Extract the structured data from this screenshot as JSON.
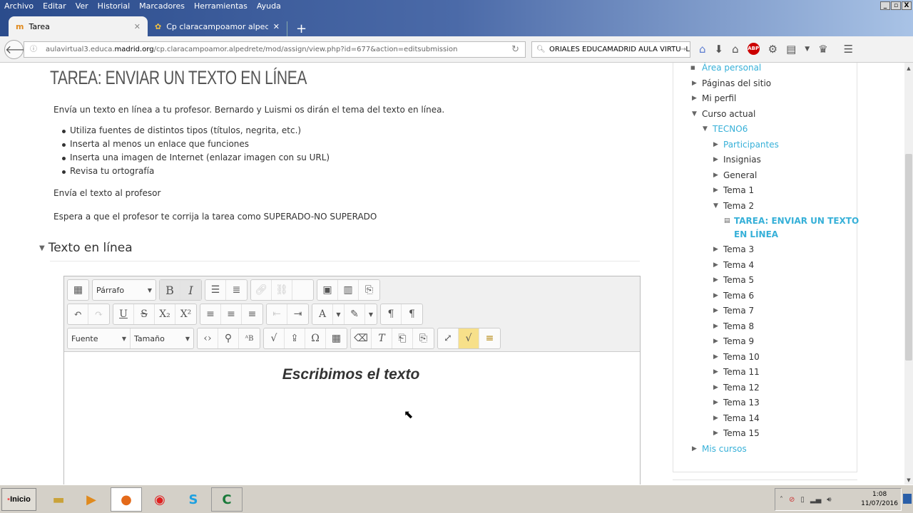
{
  "browser": {
    "menu": [
      "Archivo",
      "Editar",
      "Ver",
      "Historial",
      "Marcadores",
      "Herramientas",
      "Ayuda"
    ],
    "tabs": [
      {
        "title": "Tarea",
        "icon": "moodle-icon",
        "active": true
      },
      {
        "title": "Cp claracampoamor alpedrete...",
        "icon": "school-logo-icon",
        "active": false
      }
    ],
    "new_tab": "+",
    "url_prefix": "aulavirtual3.educa.",
    "url_domain": "madrid.org",
    "url_path": "/cp.claracampoamor.alpedrete/mod/assign/view.php?id=677&action=editsubmission",
    "search_value": "ORIALES EDUCAMADRID AULA VIRTUAL",
    "toolbar_icons": [
      "pocket-icon",
      "download-icon",
      "home-icon",
      "adblock-icon",
      "extension-icon",
      "clipboard-icon",
      "chevron-down-icon",
      "crown-icon",
      "menu-icon"
    ],
    "abp_label": "ABP"
  },
  "page": {
    "title": "TAREA: ENVIAR UN TEXTO EN LÍNEA",
    "intro": "Envía un texto en línea a tu profesor. Bernardo y Luismi os dirán el tema del texto en línea.",
    "bullets": [
      "Utiliza fuentes de distintos tipos (títulos, negrita, etc.)",
      "Inserta al menos un enlace que funciones",
      "Inserta una imagen de Internet (enlazar imagen con su URL)",
      "Revisa tu ortografía"
    ],
    "send": "Envía el texto al profesor",
    "wait": "Espera a que el profesor te corrija la tarea como SUPERADO-NO SUPERADO",
    "section": "Texto en línea",
    "editor": {
      "paragraph_select": "Párrafo",
      "font_select": "Fuente",
      "size_select": "Tamaño",
      "content": "Escribimos el texto"
    }
  },
  "sidebar": {
    "items": [
      {
        "label": "Área personal",
        "level": 0,
        "mark": "bullet",
        "link": true
      },
      {
        "label": "Páginas del sitio",
        "level": 0,
        "mark": "collapsed",
        "link": false
      },
      {
        "label": "Mi perfil",
        "level": 0,
        "mark": "collapsed",
        "link": false
      },
      {
        "label": "Curso actual",
        "level": 0,
        "mark": "expanded",
        "link": false
      },
      {
        "label": "TECNO6",
        "level": 1,
        "mark": "expanded",
        "link": true
      },
      {
        "label": "Participantes",
        "level": 2,
        "mark": "collapsed",
        "link": true
      },
      {
        "label": "Insignias",
        "level": 2,
        "mark": "collapsed",
        "link": false
      },
      {
        "label": "General",
        "level": 2,
        "mark": "collapsed",
        "link": false
      },
      {
        "label": "Tema 1",
        "level": 2,
        "mark": "collapsed",
        "link": false
      },
      {
        "label": "Tema 2",
        "level": 2,
        "mark": "expanded",
        "link": false
      },
      {
        "label": "TAREA: ENVIAR UN TEXTO",
        "label2": "EN LÍNEA",
        "level": 3,
        "mark": "assign",
        "link": true,
        "bold": true
      },
      {
        "label": "Tema 3",
        "level": 2,
        "mark": "collapsed",
        "link": false
      },
      {
        "label": "Tema 4",
        "level": 2,
        "mark": "collapsed",
        "link": false
      },
      {
        "label": "Tema 5",
        "level": 2,
        "mark": "collapsed",
        "link": false
      },
      {
        "label": "Tema 6",
        "level": 2,
        "mark": "collapsed",
        "link": false
      },
      {
        "label": "Tema 7",
        "level": 2,
        "mark": "collapsed",
        "link": false
      },
      {
        "label": "Tema 8",
        "level": 2,
        "mark": "collapsed",
        "link": false
      },
      {
        "label": "Tema 9",
        "level": 2,
        "mark": "collapsed",
        "link": false
      },
      {
        "label": "Tema 10",
        "level": 2,
        "mark": "collapsed",
        "link": false
      },
      {
        "label": "Tema 11",
        "level": 2,
        "mark": "collapsed",
        "link": false
      },
      {
        "label": "Tema 12",
        "level": 2,
        "mark": "collapsed",
        "link": false
      },
      {
        "label": "Tema 13",
        "level": 2,
        "mark": "collapsed",
        "link": false
      },
      {
        "label": "Tema 14",
        "level": 2,
        "mark": "collapsed",
        "link": false
      },
      {
        "label": "Tema 15",
        "level": 2,
        "mark": "collapsed",
        "link": false
      },
      {
        "label": "Mis cursos",
        "level": 0,
        "mark": "collapsed",
        "link": true
      }
    ]
  },
  "taskbar": {
    "start": "Inicio",
    "apps": [
      "file-explorer-icon",
      "media-player-icon",
      "firefox-icon",
      "screen-recorder-icon",
      "skype-icon",
      "camtasia-icon"
    ],
    "time": "1:08",
    "date": "11/07/2016"
  }
}
